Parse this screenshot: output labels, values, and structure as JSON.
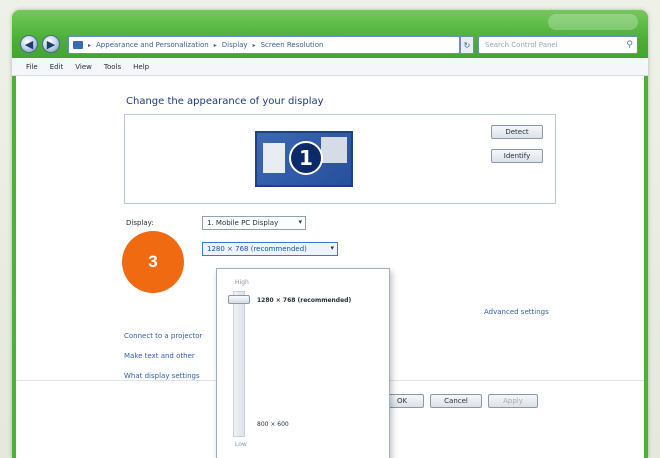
{
  "window": {
    "address_path": [
      "Appearance and Personalization",
      "Display",
      "Screen Resolution"
    ],
    "search_placeholder": "Search Control Panel"
  },
  "menu": [
    "File",
    "Edit",
    "View",
    "Tools",
    "Help"
  ],
  "main": {
    "heading": "Change the appearance of your display",
    "detect_label": "Detect",
    "identify_label": "Identify",
    "monitor_number": "1",
    "display_label": "Display:",
    "display_value": "1. Mobile PC Display",
    "resolution_value": "1280 × 768 (recommended)",
    "advanced_link": "Advanced settings",
    "links": [
      "Connect to a projector",
      "Make text and other",
      "What display settings"
    ]
  },
  "dropdown": {
    "high_label": "High",
    "low_label": "Low",
    "top_resolution": "1280 × 768 (recommended)",
    "bottom_resolution": "800 × 600",
    "slider_level": 1.0
  },
  "footer": {
    "ok_label": "OK",
    "cancel_label": "Cancel",
    "apply_label": "Apply"
  },
  "callout": {
    "step_number": "3",
    "color": "#f06a12"
  }
}
